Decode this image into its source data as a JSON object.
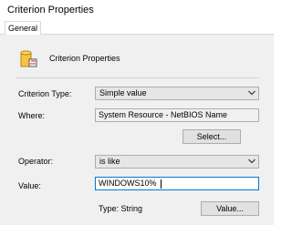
{
  "window": {
    "title": "Criterion Properties"
  },
  "tabs": [
    {
      "label": "General"
    }
  ],
  "header": {
    "text": "Criterion Properties",
    "icon": "criterion-icon"
  },
  "form": {
    "criterion_type_label": "Criterion Type:",
    "criterion_type_value": "Simple value",
    "where_label": "Where:",
    "where_value": "System Resource - NetBIOS Name",
    "select_button": "Select...",
    "operator_label": "Operator:",
    "operator_value": "is like",
    "value_label": "Value:",
    "value_value": "WINDOWS10%",
    "type_text": "Type: String",
    "value_button": "Value..."
  }
}
